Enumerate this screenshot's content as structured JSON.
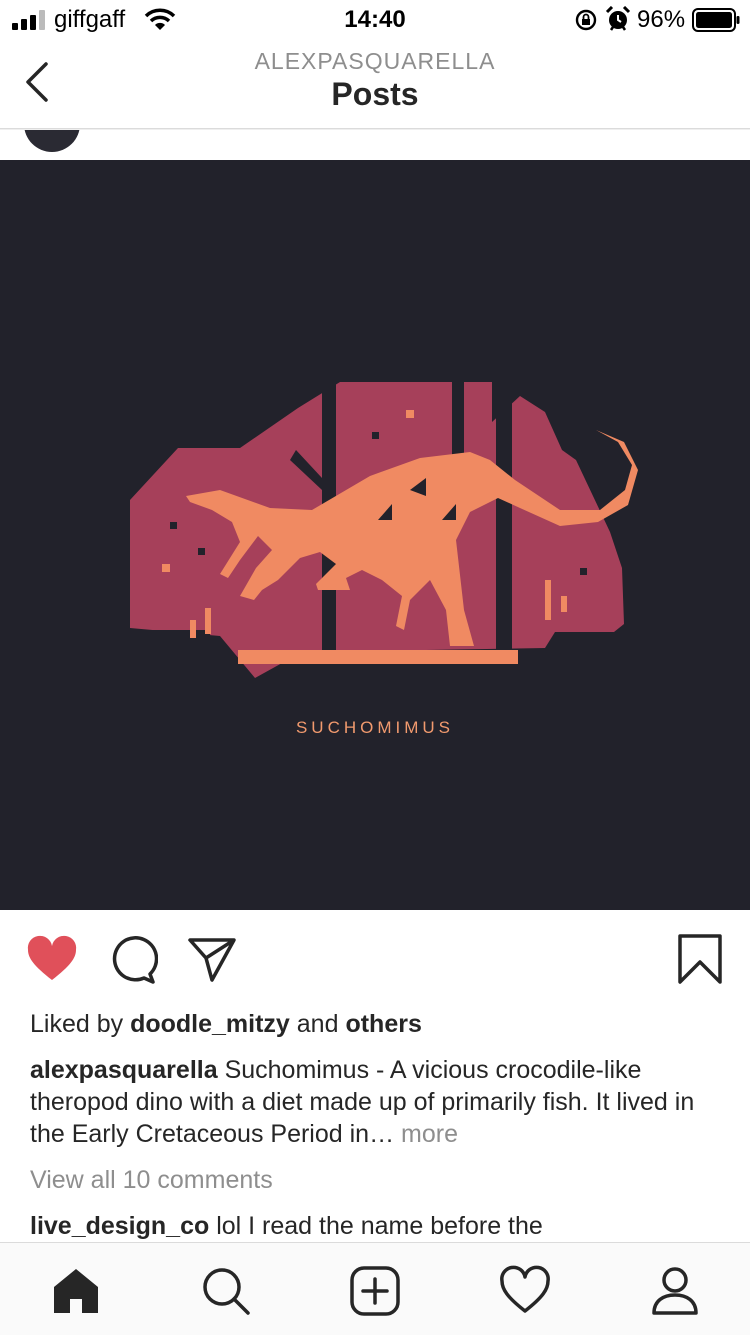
{
  "status": {
    "carrier": "giffgaff",
    "time": "14:40",
    "battery": "96%"
  },
  "header": {
    "username": "ALEXPASQUARELLA",
    "title": "Posts"
  },
  "post": {
    "image_caption": "SUCHOMIMUS",
    "liked_prefix": "Liked by",
    "liked_user": "doodle_mitzy",
    "liked_and": "and",
    "liked_others": "others",
    "caption_user": "alexpasquarella",
    "caption_text": "Suchomimus - A vicious crocodile-like theropod dino with a diet made up of primarily fish. It lived in the Early Cretaceous Period in…",
    "more": "more",
    "view_all": "View all 10 comments",
    "comment_user": "live_design_co",
    "comment_text": "lol I read the name before the"
  },
  "colors": {
    "like": "#e0505a",
    "image_bg": "#22222b",
    "art_magenta": "#a6405a",
    "art_orange": "#f08a62"
  },
  "icons": [
    "signal-icon",
    "wifi-icon",
    "lock-rotation-icon",
    "alarm-icon",
    "battery-icon",
    "back-chevron-icon",
    "heart-filled-icon",
    "comment-icon",
    "share-icon",
    "bookmark-icon",
    "home-icon",
    "search-icon",
    "add-icon",
    "heart-icon",
    "profile-icon"
  ]
}
